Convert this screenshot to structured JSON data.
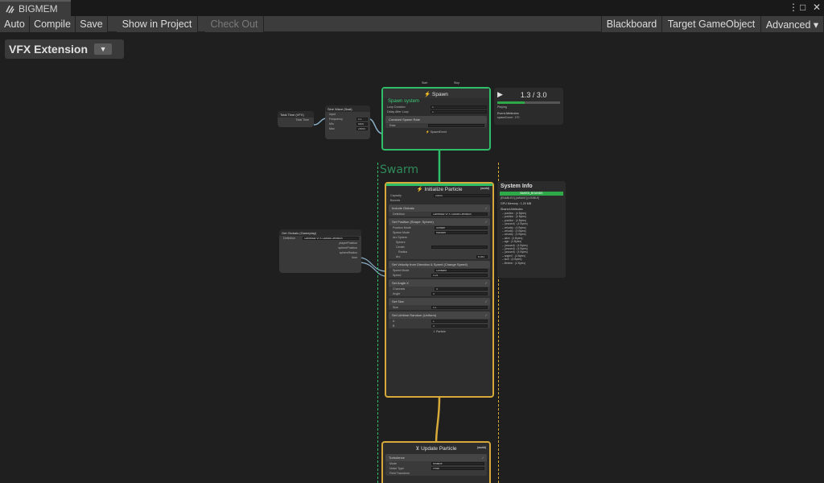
{
  "window": {
    "tab_title": "BIGMEM",
    "menu_glyph": "⋮",
    "maximize_glyph": "□",
    "close_glyph": "✕"
  },
  "toolbar": {
    "auto": "Auto",
    "compile": "Compile",
    "save": "Save",
    "show_in_project": "Show in Project",
    "check_out": "Check Out",
    "blackboard": "Blackboard",
    "target_gameobject": "Target GameObject",
    "advanced": "Advanced ▾"
  },
  "graph": {
    "title": "VFX Extension",
    "dropdown_glyph": "▼",
    "swarm_label": "Swarm"
  },
  "total_time_node": {
    "title": "Total Time (VFX)",
    "output": "Total Time"
  },
  "sine_node": {
    "title": "Sine Wave (float)",
    "rows": [
      {
        "label": "Input",
        "value": ""
      },
      {
        "label": "Frequency",
        "value": "0.1"
      },
      {
        "label": "Min",
        "value": "5000"
      },
      {
        "label": "Max",
        "value": "20000"
      }
    ]
  },
  "spawn": {
    "start": "Start",
    "stop": "Stop",
    "title": "Spawn",
    "system_name": "Spawn system",
    "rows": [
      {
        "label": "Loop Duration",
        "value": "1"
      },
      {
        "label": "Delay After Loop",
        "value": "1"
      }
    ],
    "block": "Constant Spawn Rate",
    "rate_label": "Rate",
    "output": "SpawnEvent"
  },
  "playback": {
    "play_glyph": "▶",
    "time": "1.3 / 3.0",
    "state": "Playing",
    "event_attributes": "Event Attributes",
    "spawn_count": "spawnCount : 170",
    "progress": 0.43
  },
  "initialize": {
    "title": "Initialize Particle",
    "space": "(world)",
    "capacity_label": "Capacity",
    "capacity_value": "20000",
    "bounds_label": "Bounds",
    "blocks": [
      {
        "title": "Include Globals",
        "rows": [
          {
            "label": "Definition",
            "value": "Gameplay VFX Globals Definition"
          }
        ]
      },
      {
        "title": "Set Position (Shape: Sphere)",
        "rows": [
          {
            "label": "Position Mode",
            "value": "Surface"
          },
          {
            "label": "Spawn Mode",
            "value": "Random"
          }
        ]
      }
    ],
    "sphere_label": "Arc Sphere",
    "sphere_sub": "Sphere",
    "center_label": "Center",
    "radius_label": "Radius",
    "arc_label": "Arc",
    "arc_value": "6.283",
    "velocity_block": "Set Velocity from Direction & Speed (Change Speed)",
    "speed_mode_label": "Speed Mode",
    "speed_mode_value": "Constant",
    "speed_label": "Speed",
    "speed_value": "0.24",
    "angle_block": "Set Angle.X",
    "channels_label": "Channels",
    "channels_value": "X",
    "angle_label": "Angle",
    "angle_value": "0",
    "size_block": "Set Size",
    "size_label": "Size",
    "size_value": "0.1",
    "lifetime_block": "Set Lifetime Random (Uniform)",
    "a_label": "A",
    "a_value": "1",
    "b_label": "B",
    "b_value": "3",
    "output": "Particle"
  },
  "globals_node": {
    "title": "Get Globals (Gameplay)",
    "definition_label": "Definition",
    "definition_value": "Gameplay VFX Globals Definition",
    "outputs": [
      "playerPosition",
      "spherePosition",
      "sphereRadius",
      "time"
    ]
  },
  "system_info": {
    "title": "System Info",
    "status": "BAKED_BOUNDS",
    "flags": "[ENABLED] [AWAKE] [VISIBLE]",
    "gpu_memory": "GPU Memory : 1.20 MB",
    "shared_title": "Shared Attributes",
    "attributes": [
      "position : (4 Bytes)",
      "position : (4 Bytes)",
      "position : (4 Bytes)",
      "(unused) : (4 Bytes)",
      "velocity : (4 Bytes)",
      "velocity : (4 Bytes)",
      "velocity : (4 Bytes)",
      "alive : (4 Bytes)",
      "age : (4 Bytes)",
      "(unused) : (4 Bytes)",
      "(unused) : (4 Bytes)",
      "(unused) : (4 Bytes)",
      "angleX : (4 Bytes)",
      "size : (4 Bytes)",
      "lifetime : (4 Bytes)"
    ]
  },
  "update": {
    "title": "Update Particle",
    "space": "(world)",
    "block": "Turbulence",
    "rows": [
      {
        "label": "Mode",
        "value": "Relative"
      },
      {
        "label": "Noise Type",
        "value": "Perlin"
      }
    ],
    "field_transform": "Field Transform"
  }
}
